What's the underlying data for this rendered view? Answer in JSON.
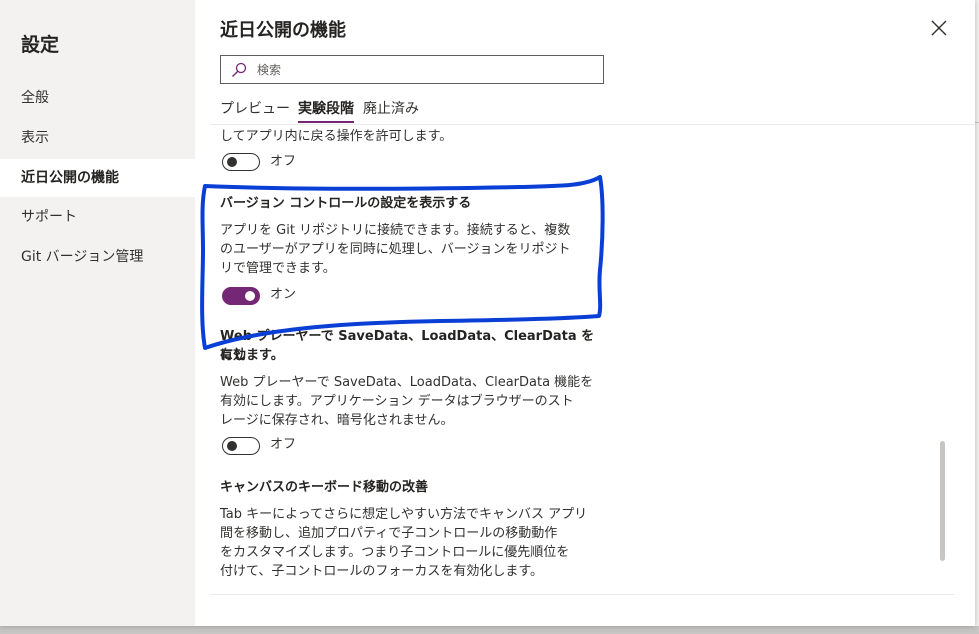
{
  "sidebar": {
    "title": "設定",
    "items": [
      {
        "label": "全般",
        "active": false
      },
      {
        "label": "表示",
        "active": false
      },
      {
        "label": "近日公開の機能",
        "active": true
      },
      {
        "label": "サポート",
        "active": false
      },
      {
        "label": "Git バージョン管理",
        "active": false
      }
    ]
  },
  "panel": {
    "title": "近日公開の機能",
    "search": {
      "placeholder": "検索",
      "value": ""
    },
    "tabs": [
      {
        "label": "プレビュー",
        "active": false
      },
      {
        "label": "実験段階",
        "active": true
      },
      {
        "label": "廃止済み",
        "active": false
      }
    ]
  },
  "features": [
    {
      "description_tail": "してアプリ内に戻る操作を許可します。",
      "toggle_state": "off",
      "toggle_label": "オフ"
    },
    {
      "title": "バージョン コントロールの設定を表示する",
      "description_lines": [
        "アプリを Git リポジトリに接続できます。接続すると、複数",
        "のユーザーがアプリを同時に処理し、バージョンをリポジト",
        "リで管理できます。"
      ],
      "toggle_state": "on",
      "toggle_label": "オン"
    },
    {
      "title_lines": [
        "Web プレーヤーで SaveData、LoadData、ClearData を有効",
        "にします。"
      ],
      "description_lines": [
        "Web プレーヤーで SaveData、LoadData、ClearData 機能を",
        "有効にします。アプリケーション データはブラウザーのスト",
        "レージに保存され、暗号化されません。"
      ],
      "toggle_state": "off",
      "toggle_label": "オフ"
    },
    {
      "title": "キャンバスのキーボード移動の改善",
      "description_lines": [
        "Tab キーによってさらに想定しやすい方法でキャンバス アプリ",
        "間を移動し、追加プロパティで子コントロールの移動動作",
        "をカスタマイズします。つまり子コントロールに優先順位を",
        "付けて、子コントロールのフォーカスを有効化します。"
      ]
    }
  ],
  "background_fragment": "s",
  "icons": {
    "close": "close-icon",
    "search": "search-icon"
  },
  "colors": {
    "accent": "#742774",
    "annotation": "#0a3fd6",
    "sidebar_bg": "#f3f2f1"
  }
}
